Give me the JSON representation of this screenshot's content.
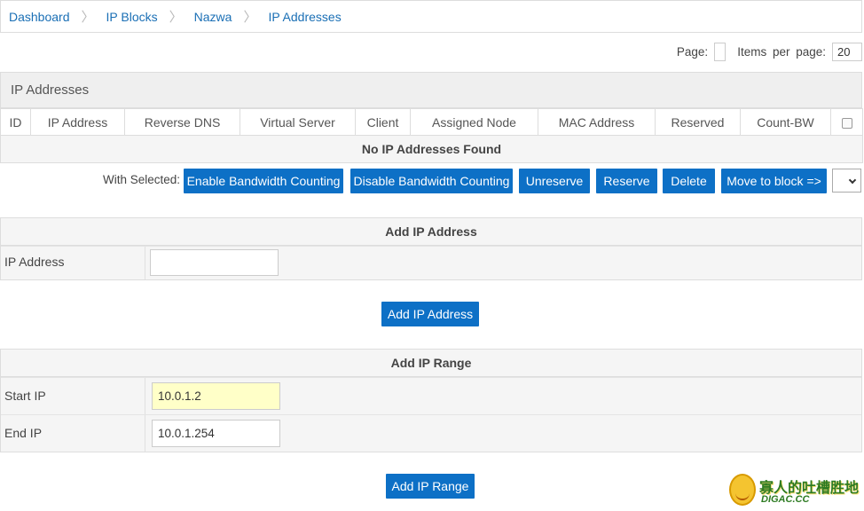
{
  "breadcrumb": [
    "Dashboard",
    "IP Blocks",
    "Nazwa",
    "IP Addresses"
  ],
  "pager": {
    "page_label": "Page:",
    "page_value": "",
    "items_label": "Items per page:",
    "items_value": "20"
  },
  "panel": {
    "title": "IP Addresses"
  },
  "table": {
    "columns": [
      "ID",
      "IP Address",
      "Reverse DNS",
      "Virtual Server",
      "Client",
      "Assigned Node",
      "MAC Address",
      "Reserved",
      "Count-BW"
    ],
    "empty_message": "No IP Addresses Found"
  },
  "actions": {
    "with_selected_label": "With Selected:",
    "buttons": [
      "Enable Bandwidth Counting",
      "Disable Bandwidth Counting",
      "Unreserve",
      "Reserve",
      "Delete",
      "Move to block =>"
    ]
  },
  "add_ip": {
    "title": "Add IP Address",
    "field_label": "IP Address",
    "field_value": "",
    "button": "Add IP Address"
  },
  "add_range": {
    "title": "Add IP Range",
    "start_label": "Start IP",
    "start_value": "10.0.1.2",
    "end_label": "End IP",
    "end_value": "10.0.1.254",
    "button": "Add IP Range"
  },
  "watermark": {
    "cn": "寡人的吐槽胜地",
    "en": "DIGAC.CC"
  },
  "colors": {
    "primary_button": "#0d70c6",
    "link": "#1a6fb5",
    "highlight_input": "#ffffc8"
  }
}
